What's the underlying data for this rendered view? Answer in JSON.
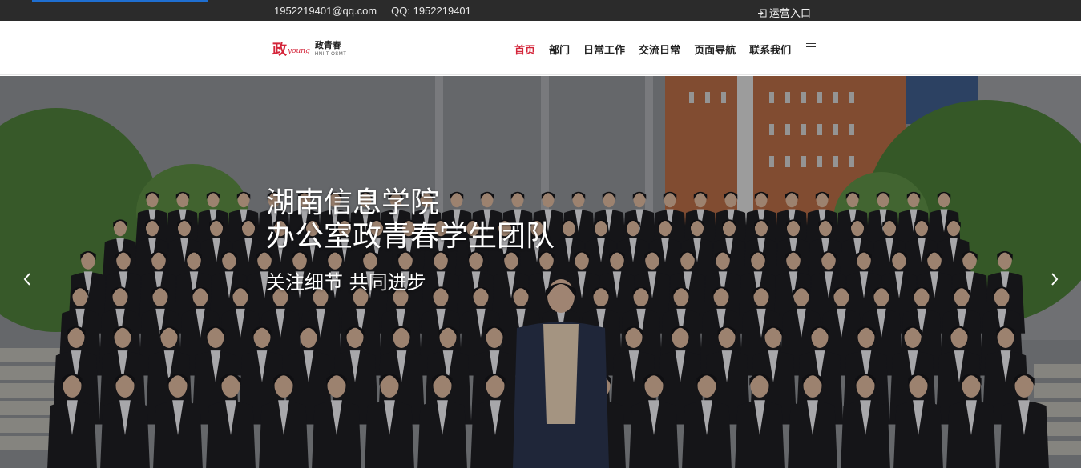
{
  "topbar": {
    "email": "1952219401@qq.com",
    "qq": "QQ: 1952219401",
    "ops_link_label": "运营入口",
    "ops_link_icon": "login-icon"
  },
  "header": {
    "logo": {
      "seal_text": "政",
      "script_text": "young",
      "name_cn": "政青春",
      "name_en": "HNIIT OSMT"
    },
    "nav": [
      {
        "label": "首页",
        "active": true
      },
      {
        "label": "部门",
        "active": false
      },
      {
        "label": "日常工作",
        "active": false
      },
      {
        "label": "交流日常",
        "active": false
      },
      {
        "label": "页面导航",
        "active": false
      },
      {
        "label": "联系我们",
        "active": false
      }
    ],
    "menu_icon": "hamburger-menu-icon"
  },
  "hero": {
    "title_line1": "湖南信息学院",
    "title_line2": "办公室政青春学生团队",
    "subtitle": "关注细节  共同进步",
    "prev_icon": "chevron-left-icon",
    "next_icon": "chevron-right-icon"
  },
  "colors": {
    "topbar_bg": "#2b2b2b",
    "accent_red": "#d4253a",
    "accent_blue": "#1f6fd1"
  }
}
